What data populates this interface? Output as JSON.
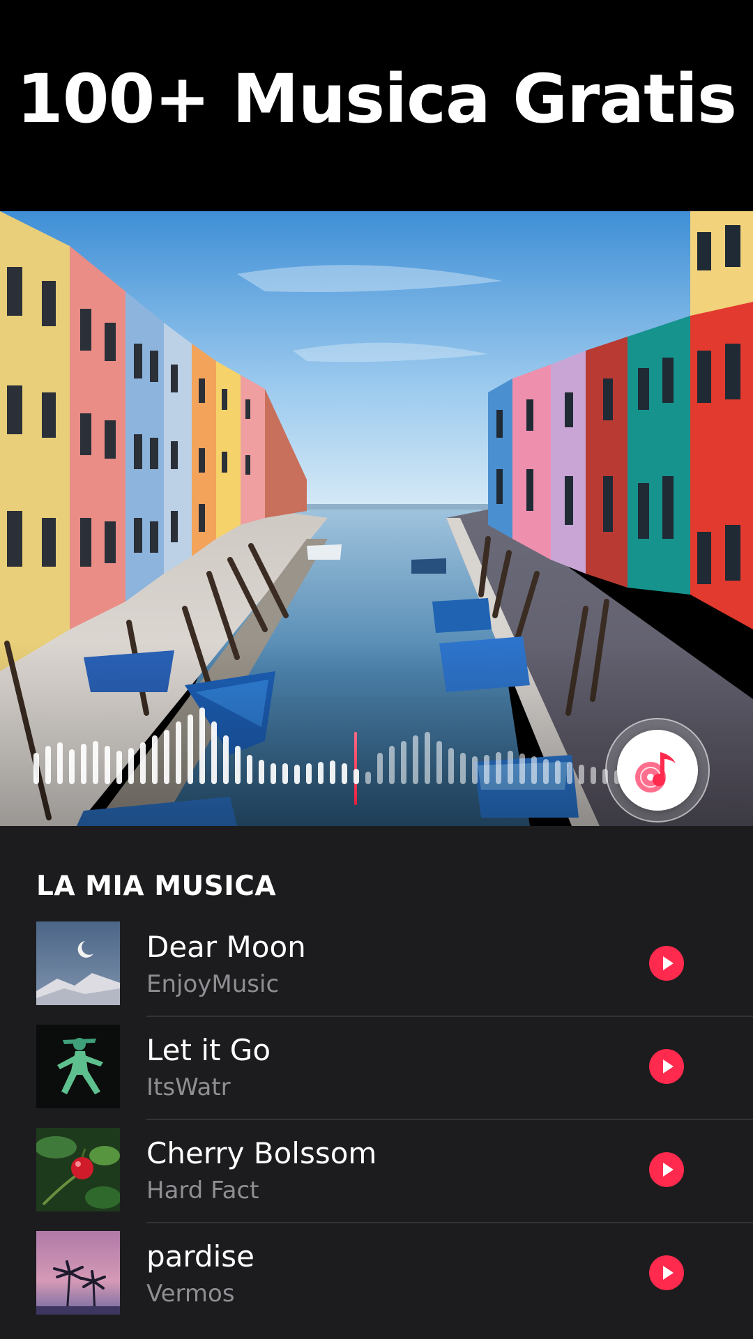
{
  "header": {
    "title": "100+ Musica Gratis"
  },
  "hero": {
    "image_icon": "canal-photo",
    "waveform_icon": "audio-waveform",
    "music_button_icon": "music-note-disc-icon"
  },
  "library": {
    "section_title": "LA MIA MUSICA",
    "tracks": [
      {
        "title": "Dear Moon",
        "artist": "EnjoyMusic",
        "thumb_icon": "moon-night-thumbnail"
      },
      {
        "title": "Let it Go",
        "artist": "ItsWatr",
        "thumb_icon": "walking-figure-thumbnail"
      },
      {
        "title": "Cherry Bolssom",
        "artist": "Hard Fact",
        "thumb_icon": "red-berry-thumbnail"
      },
      {
        "title": "pardise",
        "artist": "Vermos",
        "thumb_icon": "palm-trees-thumbnail"
      }
    ],
    "play_icon": "play-icon"
  },
  "colors": {
    "accent": "#ff2a4d",
    "background": "#000000",
    "list_background": "#1c1c1e",
    "secondary_text": "#8e8e93"
  }
}
